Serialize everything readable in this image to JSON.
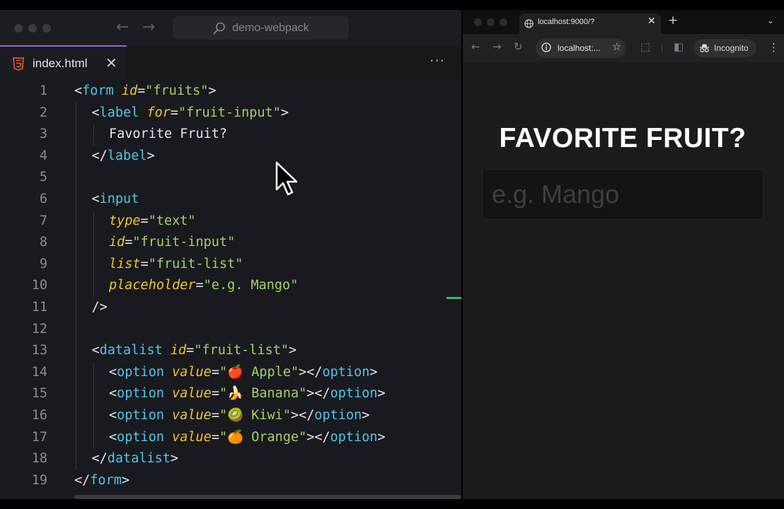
{
  "editor": {
    "command_center": "demo-webpack",
    "tab": {
      "filename": "index.html"
    },
    "lines": [
      {
        "num": "1",
        "indent": 0,
        "tokens": [
          [
            "tg",
            "<"
          ],
          [
            "tn",
            "form"
          ],
          [
            "tg",
            " "
          ],
          [
            "at",
            "id"
          ],
          [
            "eq",
            "="
          ],
          [
            "st",
            "\"fruits\""
          ],
          [
            "tg",
            ">"
          ]
        ]
      },
      {
        "num": "2",
        "indent": 1,
        "tokens": [
          [
            "tg",
            "<"
          ],
          [
            "tn",
            "label"
          ],
          [
            "tg",
            " "
          ],
          [
            "at",
            "for"
          ],
          [
            "eq",
            "="
          ],
          [
            "st",
            "\"fruit-input\""
          ],
          [
            "tg",
            ">"
          ]
        ]
      },
      {
        "num": "3",
        "indent": 2,
        "tokens": [
          [
            "tg",
            "Favorite Fruit?"
          ]
        ]
      },
      {
        "num": "4",
        "indent": 1,
        "tokens": [
          [
            "tg",
            "</"
          ],
          [
            "tn",
            "label"
          ],
          [
            "tg",
            ">"
          ]
        ]
      },
      {
        "num": "5",
        "indent": 1,
        "tokens": []
      },
      {
        "num": "6",
        "indent": 1,
        "tokens": [
          [
            "tg",
            "<"
          ],
          [
            "tn",
            "input"
          ]
        ]
      },
      {
        "num": "7",
        "indent": 2,
        "tokens": [
          [
            "at",
            "type"
          ],
          [
            "eq",
            "="
          ],
          [
            "st",
            "\"text\""
          ]
        ]
      },
      {
        "num": "8",
        "indent": 2,
        "tokens": [
          [
            "at",
            "id"
          ],
          [
            "eq",
            "="
          ],
          [
            "st",
            "\"fruit-input\""
          ]
        ]
      },
      {
        "num": "9",
        "indent": 2,
        "tokens": [
          [
            "at",
            "list"
          ],
          [
            "eq",
            "="
          ],
          [
            "st",
            "\"fruit-list\""
          ]
        ]
      },
      {
        "num": "10",
        "indent": 2,
        "tokens": [
          [
            "at",
            "placeholder"
          ],
          [
            "eq",
            "="
          ],
          [
            "st",
            "\"e.g. Mango\""
          ]
        ]
      },
      {
        "num": "11",
        "indent": 1,
        "tokens": [
          [
            "tg",
            "/>"
          ]
        ]
      },
      {
        "num": "12",
        "indent": 1,
        "tokens": []
      },
      {
        "num": "13",
        "indent": 1,
        "tokens": [
          [
            "tg",
            "<"
          ],
          [
            "tn",
            "datalist"
          ],
          [
            "tg",
            " "
          ],
          [
            "at",
            "id"
          ],
          [
            "eq",
            "="
          ],
          [
            "st",
            "\"fruit-list\""
          ],
          [
            "tg",
            ">"
          ]
        ]
      },
      {
        "num": "14",
        "indent": 2,
        "tokens": [
          [
            "tg",
            "<"
          ],
          [
            "tn",
            "option"
          ],
          [
            "tg",
            " "
          ],
          [
            "at",
            "value"
          ],
          [
            "eq",
            "="
          ],
          [
            "st",
            "\"🍎 Apple\""
          ],
          [
            "tg",
            "></"
          ],
          [
            "tn",
            "option"
          ],
          [
            "tg",
            ">"
          ]
        ]
      },
      {
        "num": "15",
        "indent": 2,
        "tokens": [
          [
            "tg",
            "<"
          ],
          [
            "tn",
            "option"
          ],
          [
            "tg",
            " "
          ],
          [
            "at",
            "value"
          ],
          [
            "eq",
            "="
          ],
          [
            "st",
            "\"🍌 Banana\""
          ],
          [
            "tg",
            "></"
          ],
          [
            "tn",
            "option"
          ],
          [
            "tg",
            ">"
          ]
        ]
      },
      {
        "num": "16",
        "indent": 2,
        "tokens": [
          [
            "tg",
            "<"
          ],
          [
            "tn",
            "option"
          ],
          [
            "tg",
            " "
          ],
          [
            "at",
            "value"
          ],
          [
            "eq",
            "="
          ],
          [
            "st",
            "\"🥝 Kiwi\""
          ],
          [
            "tg",
            "></"
          ],
          [
            "tn",
            "option"
          ],
          [
            "tg",
            ">"
          ]
        ]
      },
      {
        "num": "17",
        "indent": 2,
        "tokens": [
          [
            "tg",
            "<"
          ],
          [
            "tn",
            "option"
          ],
          [
            "tg",
            " "
          ],
          [
            "at",
            "value"
          ],
          [
            "eq",
            "="
          ],
          [
            "st",
            "\"🍊 Orange\""
          ],
          [
            "tg",
            "></"
          ],
          [
            "tn",
            "option"
          ],
          [
            "tg",
            ">"
          ]
        ]
      },
      {
        "num": "18",
        "indent": 1,
        "tokens": [
          [
            "tg",
            "</"
          ],
          [
            "tn",
            "datalist"
          ],
          [
            "tg",
            ">"
          ]
        ]
      },
      {
        "num": "19",
        "indent": 0,
        "tokens": [
          [
            "tg",
            "</"
          ],
          [
            "tn",
            "form"
          ],
          [
            "tg",
            ">"
          ]
        ]
      }
    ]
  },
  "browser": {
    "tab_title": "localhost:9000/?",
    "url": "localhost:...",
    "incognito_label": "Incognito"
  },
  "page": {
    "heading": "FAVORITE FRUIT?",
    "input_placeholder": "e.g. Mango",
    "input_value": ""
  },
  "colors": {
    "tag": "#e6e6e6",
    "tag_name": "#53c6e8",
    "attribute": "#f3c432",
    "string": "#9fd468",
    "tab_accent": "#a35be8",
    "git_added": "#3fb950"
  },
  "icons": [
    "html5-icon",
    "search-icon",
    "close-icon",
    "more-icon",
    "back-arrow-icon",
    "forward-arrow-icon",
    "reload-icon",
    "globe-icon",
    "info-icon",
    "star-icon",
    "extensions-icon",
    "sidepanel-icon",
    "incognito-icon",
    "kebab-menu-icon",
    "new-tab-icon",
    "tab-search-icon",
    "mouse-cursor-icon"
  ]
}
